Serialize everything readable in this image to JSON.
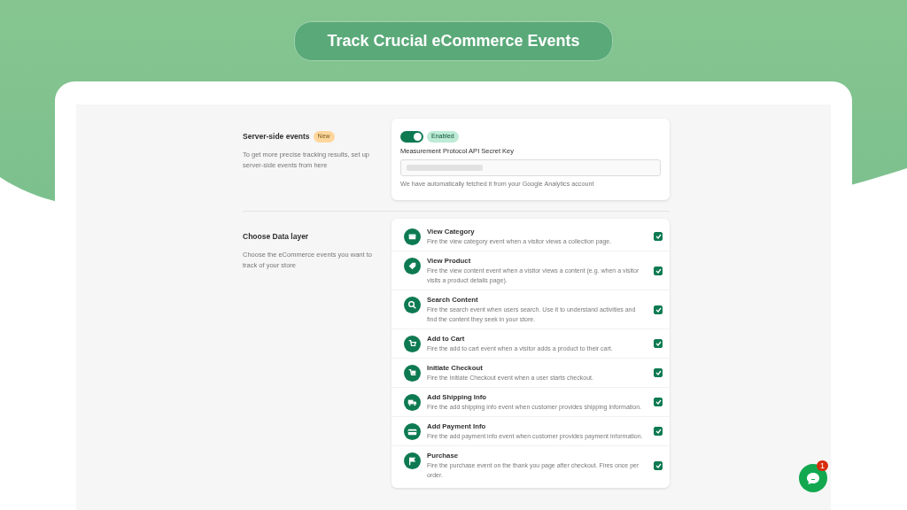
{
  "banner": {
    "title": "Track Crucial eCommerce Events"
  },
  "server_side": {
    "title": "Server-side events",
    "badge": "New",
    "description": "To get more precise tracking results, set up server-side events from here",
    "toggle": {
      "on": true
    },
    "status": "Enabled",
    "field_label": "Measurement Protocol API Secret Key",
    "help": "We have automatically fetched it from your Google Analytics account"
  },
  "data_layer": {
    "title": "Choose Data layer",
    "description": "Choose the eCommerce events you want to track of your store",
    "events": [
      {
        "name": "View Category",
        "description": "Fire the view category event when a visitor views a collection page.",
        "checked": true
      },
      {
        "name": "View Product",
        "description": "Fire the view content event when a visitor views a content (e.g. when a visitor visits a product details page).",
        "checked": true
      },
      {
        "name": "Search Content",
        "description": "Fire the search event when users search. Use it to understand activities and find the content they seek in your store.",
        "checked": true
      },
      {
        "name": "Add to Cart",
        "description": "Fire the add to cart event when a visitor adds a product to their cart.",
        "checked": true
      },
      {
        "name": "Initiate Checkout",
        "description": "Fire the Initiate Checkout event when a user starts checkout.",
        "checked": true
      },
      {
        "name": "Add Shipping Info",
        "description": "Fire the add shipping info event when customer provides shipping information.",
        "checked": true
      },
      {
        "name": "Add Payment Info",
        "description": "Fire the add payment info event when customer provides payment information.",
        "checked": true
      },
      {
        "name": "Purchase",
        "description": "Fire the purchase event on the thank you page after checkout. Fires once per order.",
        "checked": true
      }
    ]
  },
  "chat": {
    "badge": "1"
  }
}
